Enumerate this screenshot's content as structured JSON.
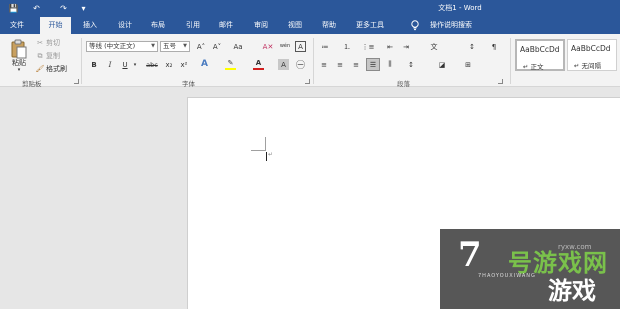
{
  "titlebar": {
    "title": "文档1 - Word",
    "qa_icons": [
      "save-icon",
      "undo-icon",
      "redo-icon",
      "customize-icon"
    ],
    "qa_glyphs": [
      "💾",
      "↶",
      "↷",
      "▾"
    ]
  },
  "tabs": [
    {
      "label": "文件"
    },
    {
      "label": "开始",
      "active": true
    },
    {
      "label": "插入"
    },
    {
      "label": "设计"
    },
    {
      "label": "布局"
    },
    {
      "label": "引用"
    },
    {
      "label": "邮件"
    },
    {
      "label": "审阅"
    },
    {
      "label": "视图"
    },
    {
      "label": "帮助"
    },
    {
      "label": "更多工具"
    },
    {
      "label": "操作说明搜索"
    }
  ],
  "clipboard": {
    "paste_label": "粘贴",
    "cut_label": "剪切",
    "copy_label": "复制",
    "format_painter_label": "格式刷",
    "group_label": "剪贴板"
  },
  "font": {
    "font_name": "等线 (中文正文)",
    "font_size": "五号",
    "grow_glyph": "A˄",
    "shrink_glyph": "A˅",
    "case_glyph": "Aa",
    "clear_glyph": "A✕",
    "phonetic_glyph": "wén",
    "border_glyph": "A",
    "bold": "B",
    "italic": "I",
    "underline": "U",
    "strike": "abc",
    "subscript": "x₂",
    "superscript": "x²",
    "effects_glyph": "A",
    "highlight_glyph": "✎",
    "color_glyph": "A",
    "shade_glyph": "A",
    "circle_glyph": "㊀",
    "group_label": "字体"
  },
  "paragraph": {
    "group_label": "段落",
    "top_row": [
      "≔",
      "⒈",
      "⋮≡",
      "⇤",
      "⇥",
      "文",
      "↕",
      "¶"
    ],
    "bottom_row": [
      "≡",
      "≡",
      "≡",
      "☰",
      "⫼",
      "↕",
      "◪",
      "⊞"
    ]
  },
  "styles": [
    {
      "preview": "AaBbCcDd",
      "name": "↵ 正文",
      "selected": true
    },
    {
      "preview": "AaBbCcDd",
      "name": "↵ 无间隔",
      "selected": false
    }
  ],
  "document": {
    "paragraph_mark": "↵"
  },
  "watermark": {
    "seven": "7",
    "brand": "号游戏网",
    "pinyin": "7HAOYOUXIWANG",
    "game": "游戏",
    "url": "ryxw.com"
  },
  "colors": {
    "accent": "#2b579a",
    "ribbon_bg": "#f3f3f3",
    "canvas_bg": "#e6e6e6",
    "font_color_bar": "#d22020",
    "highlight_bar": "#ffff00",
    "watermark_green": "#7ac14b"
  }
}
